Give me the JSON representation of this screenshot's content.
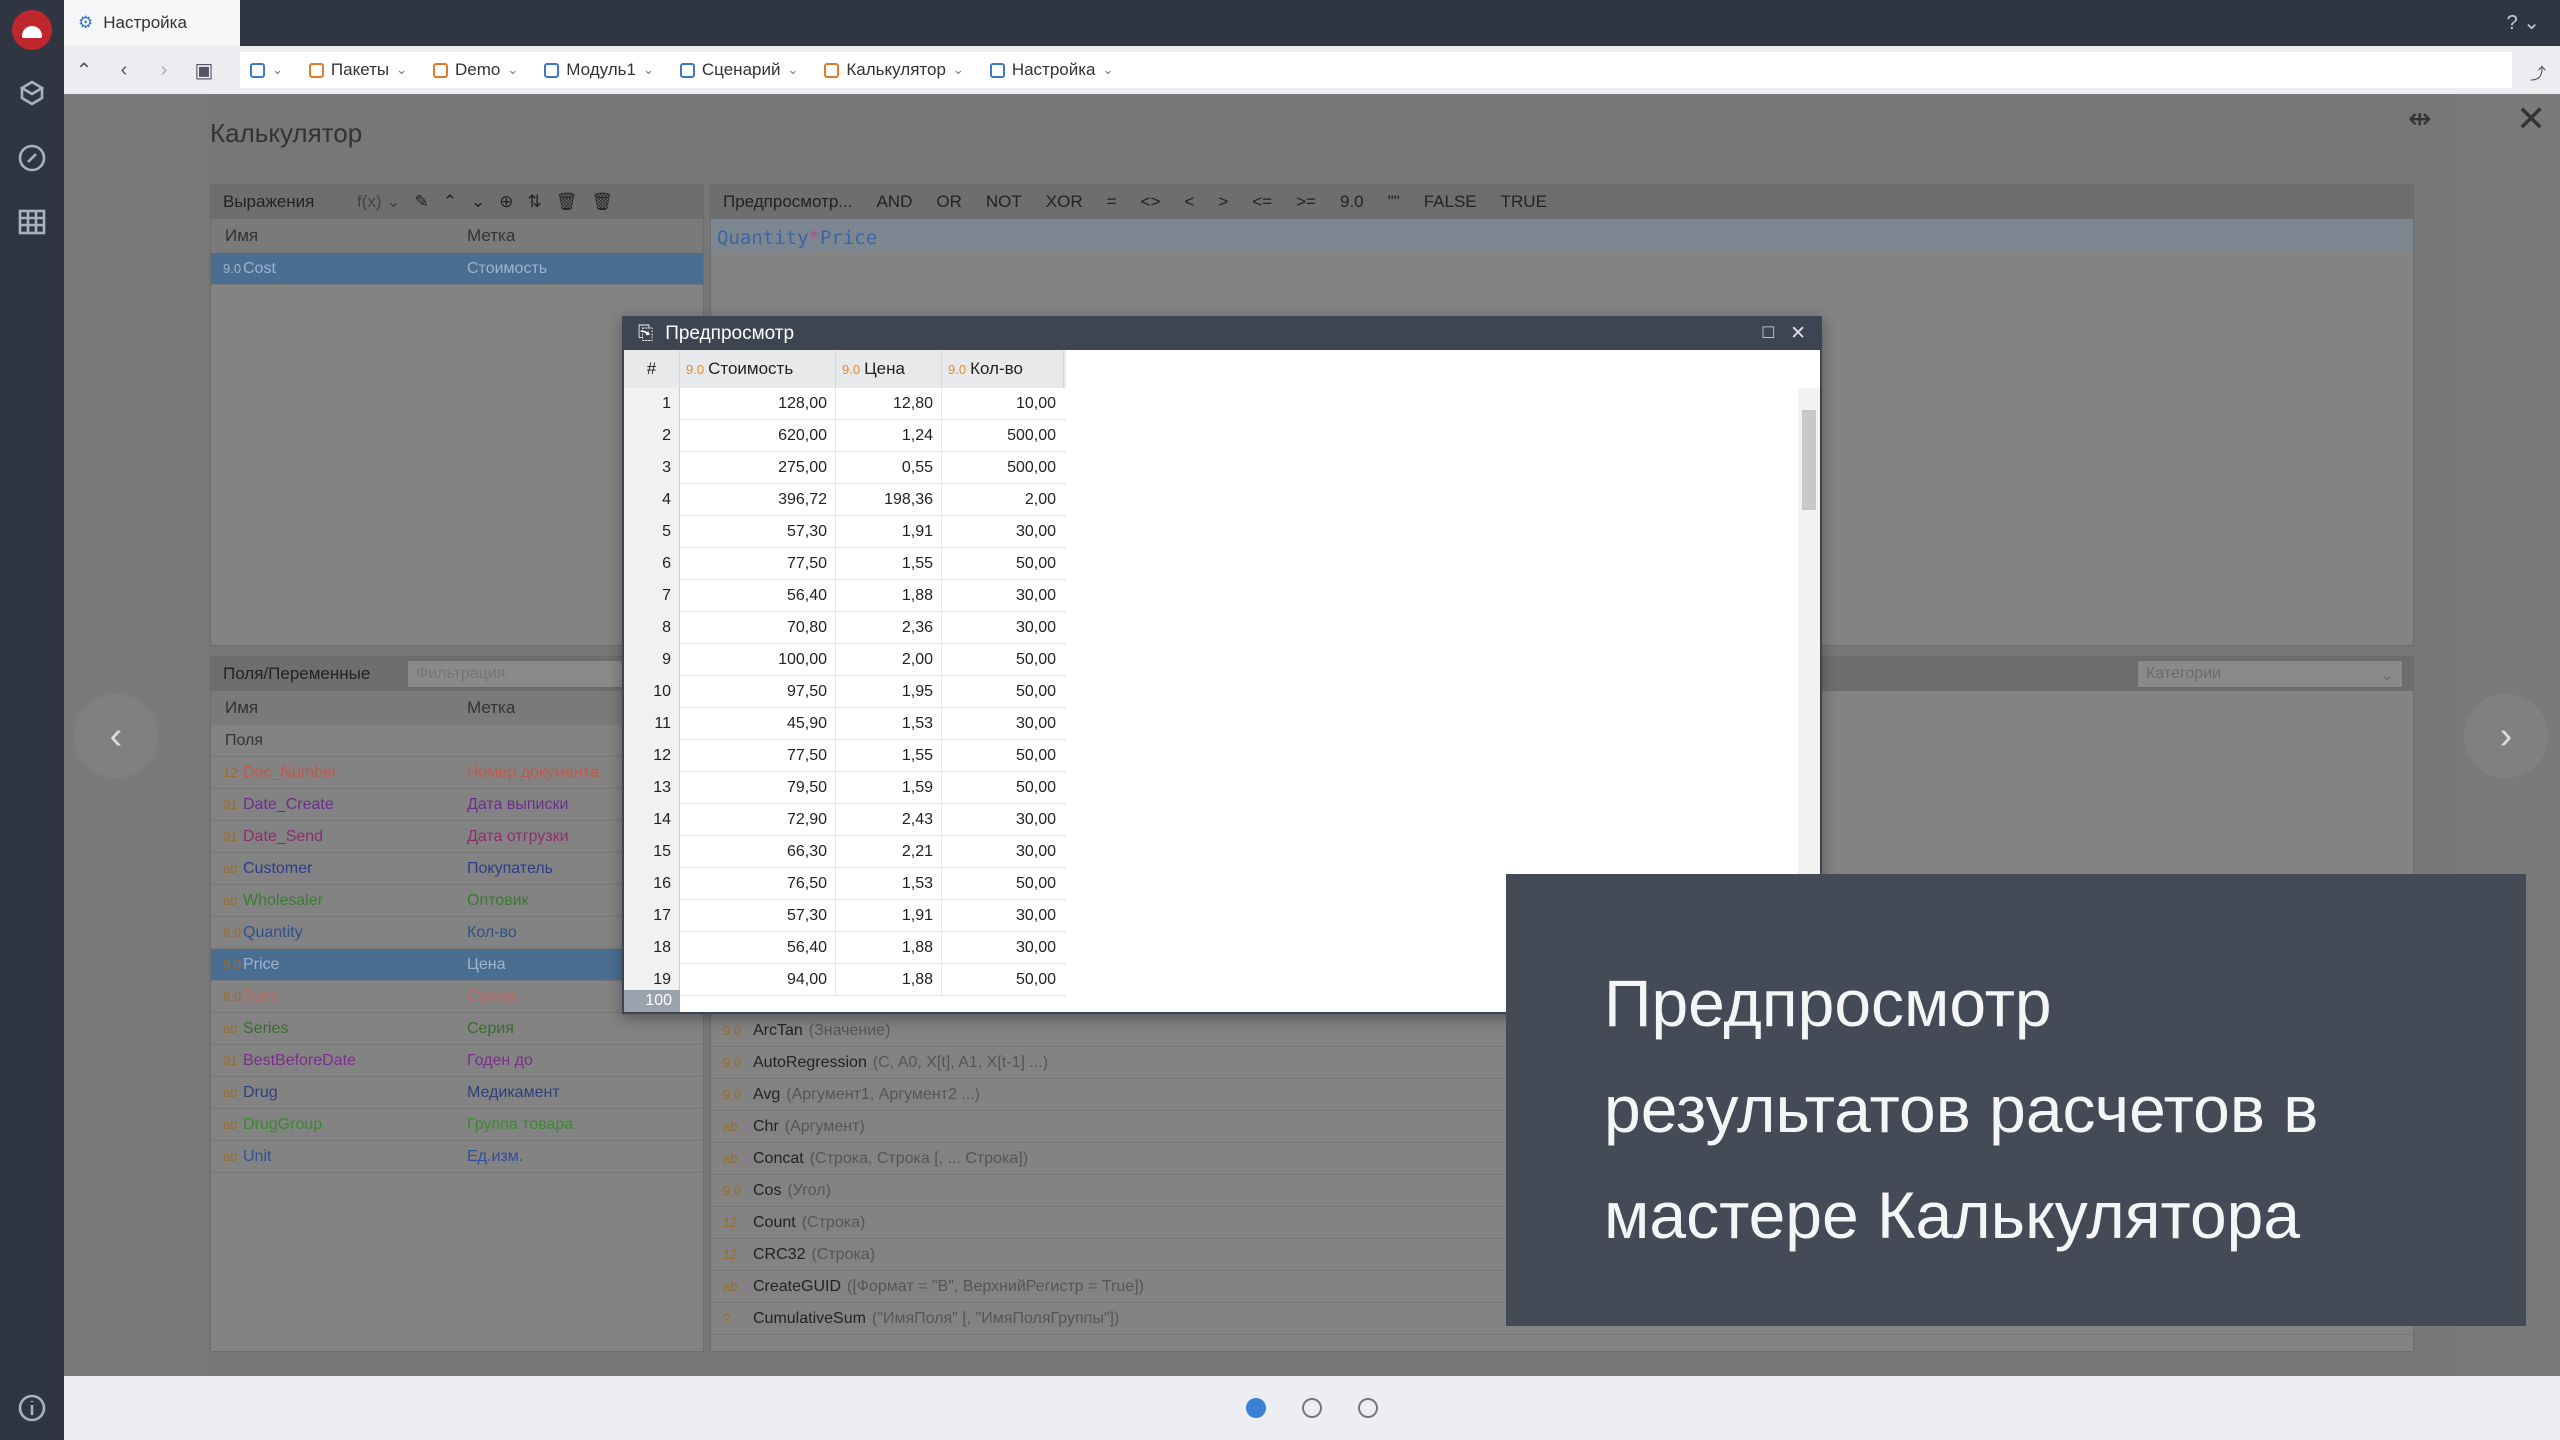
{
  "tab": {
    "title": "Настройка"
  },
  "breadcrumbs": [
    "Пакеты",
    "Demo",
    "Модуль1",
    "Сценарий",
    "Калькулятор",
    "Настройка"
  ],
  "dialog": {
    "title": "Калькулятор"
  },
  "expressions": {
    "title": "Выражения",
    "col_name": "Имя",
    "col_label": "Метка",
    "rows": [
      {
        "type": "9.0",
        "name": "Cost",
        "label": "Стоимость"
      }
    ]
  },
  "toolbar_ops": [
    "Предпросмотр...",
    "AND",
    "OR",
    "NOT",
    "XOR",
    "=",
    "<>",
    "<",
    ">",
    "<=",
    ">=",
    "9.0",
    "\"\"",
    "FALSE",
    "TRUE"
  ],
  "formula": {
    "left": "Quantity",
    "op": "*",
    "right": "Price"
  },
  "fields": {
    "title": "Поля/Переменные",
    "filter_placeholder": "Фильтрация",
    "col_name": "Имя",
    "col_label": "Метка",
    "group": "Поля",
    "rows": [
      {
        "type": "12",
        "name": "Doc_Number",
        "label": "Номер документа",
        "color": "#c0584a"
      },
      {
        "type": "31",
        "name": "Date_Create",
        "label": "Дата выписки",
        "color": "#6b2f8a"
      },
      {
        "type": "31",
        "name": "Date_Send",
        "label": "Дата отгрузки",
        "color": "#8a2f6b"
      },
      {
        "type": "ab",
        "name": "Customer",
        "label": "Покупатель",
        "color": "#2f3a8a"
      },
      {
        "type": "ab",
        "name": "Wholesaler",
        "label": "Оптовик",
        "color": "#3a7a2f"
      },
      {
        "type": "9.0",
        "name": "Quantity",
        "label": "Кол-во",
        "color": "#2f4f8a"
      },
      {
        "type": "9.0",
        "name": "Price",
        "label": "Цена",
        "color": "#9cb4cc",
        "selected": true
      },
      {
        "type": "9.0",
        "name": "Sum",
        "label": "Сумма",
        "color": "#c06a6a"
      },
      {
        "type": "ab",
        "name": "Series",
        "label": "Серия",
        "color": "#3a6a2f"
      },
      {
        "type": "31",
        "name": "BestBeforeDate",
        "label": "Годен до",
        "color": "#7a2f8a"
      },
      {
        "type": "ab",
        "name": "Drug",
        "label": "Медикамент",
        "color": "#2f3f7a"
      },
      {
        "type": "ab",
        "name": "DrugGroup",
        "label": "Группа товара",
        "color": "#3a8a2f"
      },
      {
        "type": "ab",
        "name": "Unit",
        "label": "Ед.изм.",
        "color": "#2f4f9a"
      }
    ]
  },
  "categories": {
    "placeholder": "Категории"
  },
  "functions": [
    {
      "type": "9.0",
      "name": "ArcTan",
      "args": "(Значение)"
    },
    {
      "type": "9.0",
      "name": "AutoRegression",
      "args": "(C, A0, X[t], A1, X[t-1] ...)"
    },
    {
      "type": "9.0",
      "name": "Avg",
      "args": "(Аргумент1, Аргумент2 ...)"
    },
    {
      "type": "ab",
      "name": "Chr",
      "args": "(Аргумент)"
    },
    {
      "type": "ab",
      "name": "Concat",
      "args": "(Строка, Строка [, ... Строка])"
    },
    {
      "type": "9.0",
      "name": "Cos",
      "args": "(Угол)"
    },
    {
      "type": "12",
      "name": "Count",
      "args": "(Строка)"
    },
    {
      "type": "12",
      "name": "CRC32",
      "args": "(Строка)"
    },
    {
      "type": "ab",
      "name": "CreateGUID",
      "args": "([Формат = \"B\", ВерхнийРегистр = True])"
    },
    {
      "type": "?",
      "name": "CumulativeSum",
      "args": "(\"ИмяПоля\" [, \"ИмяПоляГруппы\"])"
    }
  ],
  "preview": {
    "title": "Предпросмотр",
    "headers": [
      "#",
      "Стоимость",
      "Цена",
      "Кол-во"
    ],
    "header_type": "9.0",
    "count": "100",
    "rows": [
      [
        "1",
        "128,00",
        "12,80",
        "10,00"
      ],
      [
        "2",
        "620,00",
        "1,24",
        "500,00"
      ],
      [
        "3",
        "275,00",
        "0,55",
        "500,00"
      ],
      [
        "4",
        "396,72",
        "198,36",
        "2,00"
      ],
      [
        "5",
        "57,30",
        "1,91",
        "30,00"
      ],
      [
        "6",
        "77,50",
        "1,55",
        "50,00"
      ],
      [
        "7",
        "56,40",
        "1,88",
        "30,00"
      ],
      [
        "8",
        "70,80",
        "2,36",
        "30,00"
      ],
      [
        "9",
        "100,00",
        "2,00",
        "50,00"
      ],
      [
        "10",
        "97,50",
        "1,95",
        "50,00"
      ],
      [
        "11",
        "45,90",
        "1,53",
        "30,00"
      ],
      [
        "12",
        "77,50",
        "1,55",
        "50,00"
      ],
      [
        "13",
        "79,50",
        "1,59",
        "50,00"
      ],
      [
        "14",
        "72,90",
        "2,43",
        "30,00"
      ],
      [
        "15",
        "66,30",
        "2,21",
        "30,00"
      ],
      [
        "16",
        "76,50",
        "1,53",
        "50,00"
      ],
      [
        "17",
        "57,30",
        "1,91",
        "30,00"
      ],
      [
        "18",
        "56,40",
        "1,88",
        "30,00"
      ],
      [
        "19",
        "94,00",
        "1,88",
        "50,00"
      ]
    ]
  },
  "caption": [
    "Предпросмотр",
    "результатов расчетов в",
    "мастере Калькулятора"
  ],
  "pager": {
    "count": 3,
    "active": 0
  }
}
